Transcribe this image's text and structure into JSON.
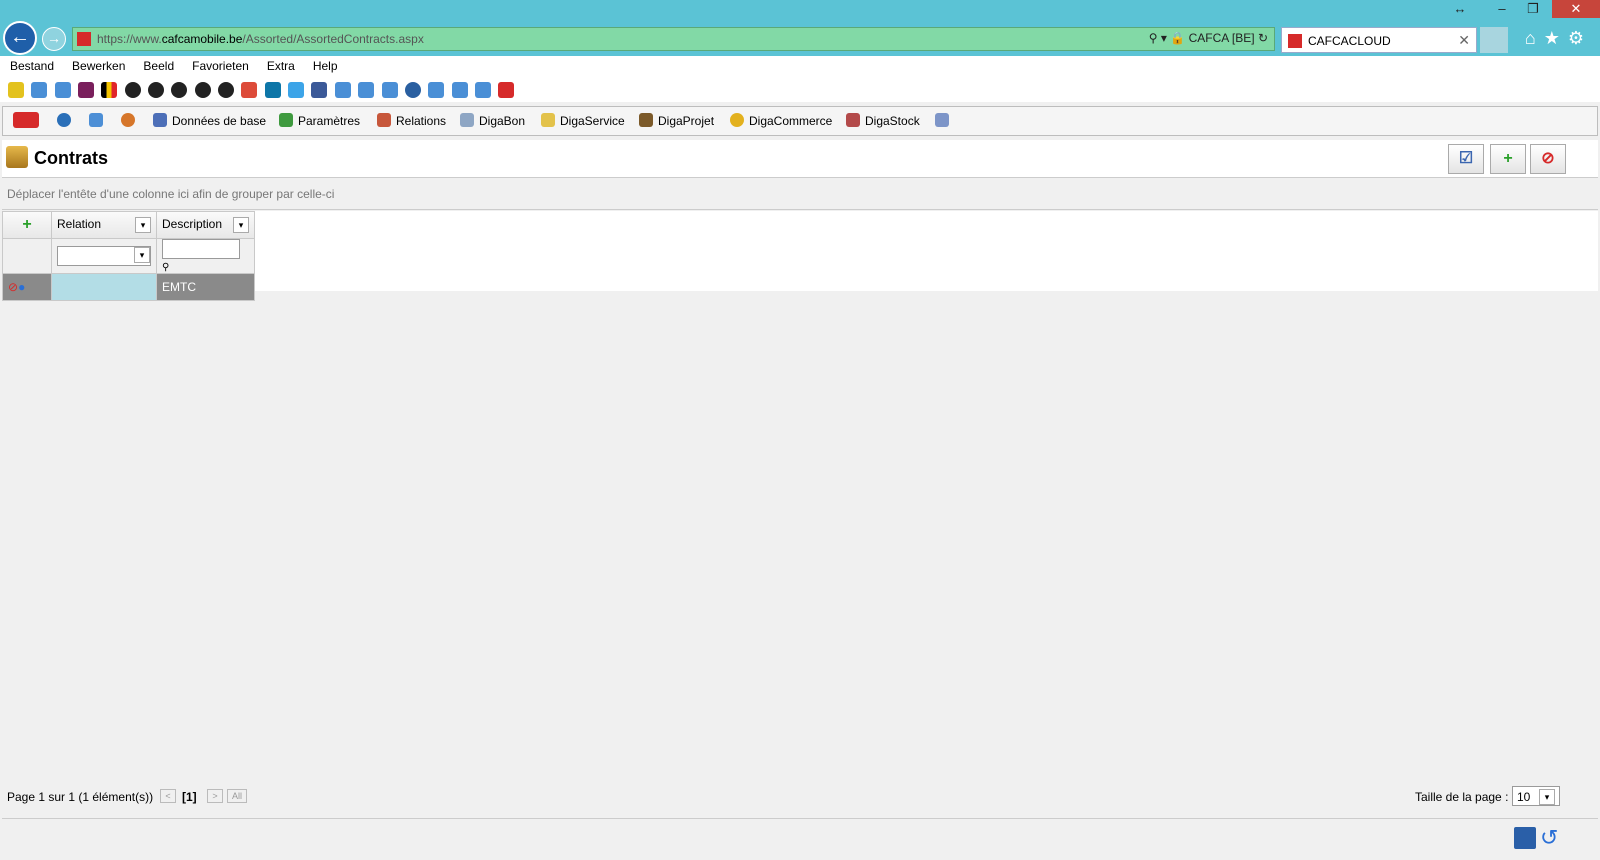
{
  "browser": {
    "url_scheme": "https://www.",
    "url_host": "cafcamobile.be",
    "url_path": "/Assorted/AssortedContracts.aspx",
    "security_label": "CAFCA [BE]",
    "tab_title": "CAFCACLOUD"
  },
  "menu": [
    "Bestand",
    "Bewerken",
    "Beeld",
    "Favorieten",
    "Extra",
    "Help"
  ],
  "app_toolbar": {
    "items": [
      "Données de base",
      "Paramètres",
      "Relations",
      "DigaBon",
      "DigaService",
      "DigaProjet",
      "DigaCommerce",
      "DigaStock"
    ]
  },
  "page": {
    "title": "Contrats",
    "group_hint": "Déplacer l'entête d'une colonne ici afin de grouper par celle-ci"
  },
  "grid": {
    "columns": [
      "Relation",
      "Description"
    ],
    "rows": [
      {
        "relation": "",
        "description": "EMTC"
      }
    ]
  },
  "pager": {
    "summary": "Page 1 sur 1 (1 élément(s))",
    "current": "[1]",
    "all_label": "All",
    "page_size_label": "Taille de la page :",
    "page_size": "10"
  }
}
